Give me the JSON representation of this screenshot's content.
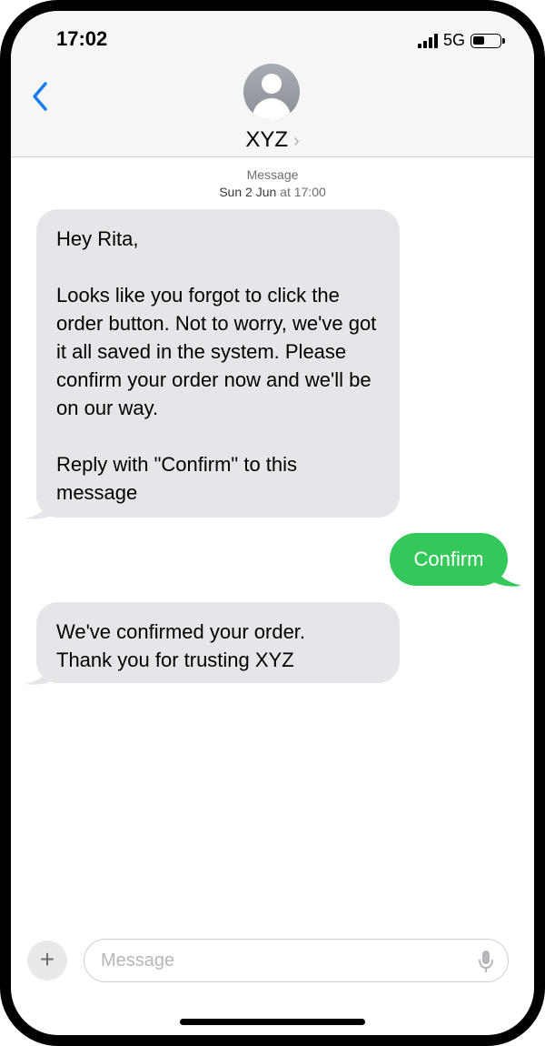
{
  "status_bar": {
    "time": "17:02",
    "network": "5G"
  },
  "header": {
    "contact_name": "XYZ",
    "back_icon": "chevron-left-icon",
    "avatar_icon": "person-silhouette-icon"
  },
  "conversation": {
    "meta_label": "Message",
    "meta_day": "Sun 2 Jun",
    "meta_at": "at 17:00",
    "messages": [
      {
        "direction": "incoming",
        "text": "Hey Rita,\n\nLooks like you forgot to click the order button. Not to worry, we've got it all saved in the system. Please confirm your order now and we'll be on our way.\n\nReply with \"Confirm\" to this message"
      },
      {
        "direction": "outgoing",
        "text": "Confirm"
      },
      {
        "direction": "incoming",
        "text": "We've confirmed your order.\nThank you for trusting XYZ"
      }
    ]
  },
  "composer": {
    "placeholder": "Message",
    "add_button": "+",
    "mic_icon": "microphone-icon"
  },
  "colors": {
    "incoming_bubble": "#e5e5ea",
    "outgoing_bubble": "#34c759",
    "accent_blue": "#1a7cf2"
  }
}
